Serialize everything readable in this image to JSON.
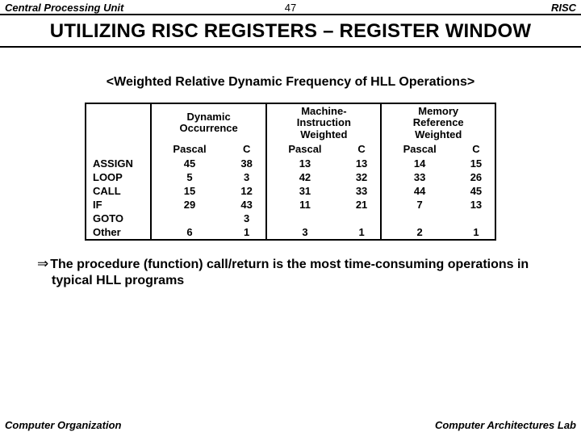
{
  "header": {
    "left": "Central Processing Unit",
    "page": "47",
    "right": "RISC"
  },
  "title": "UTILIZING RISC REGISTERS – REGISTER WINDOW",
  "subtitle": "<Weighted Relative Dynamic Frequency of HLL Operations>",
  "groups": {
    "g1": {
      "l1": "Dynamic",
      "l2": "Occurrence"
    },
    "g2": {
      "l1": "Machine-",
      "l2": "Instruction",
      "l3": "Weighted"
    },
    "g3": {
      "l1": "Memory",
      "l2": "Reference",
      "l3": "Weighted"
    }
  },
  "subcols": {
    "p": "Pascal",
    "c": "C"
  },
  "rows": {
    "r0": {
      "label": "ASSIGN",
      "g1p": "45",
      "g1c": "38",
      "g2p": "13",
      "g2c": "13",
      "g3p": "14",
      "g3c": "15"
    },
    "r1": {
      "label": "LOOP",
      "g1p": "5",
      "g1c": "3",
      "g2p": "42",
      "g2c": "32",
      "g3p": "33",
      "g3c": "26"
    },
    "r2": {
      "label": "CALL",
      "g1p": "15",
      "g1c": "12",
      "g2p": "31",
      "g2c": "33",
      "g3p": "44",
      "g3c": "45"
    },
    "r3": {
      "label": "IF",
      "g1p": "29",
      "g1c": "43",
      "g2p": "11",
      "g2c": "21",
      "g3p": "7",
      "g3c": "13"
    },
    "r4": {
      "label": "GOTO",
      "g1p": "",
      "g1c": "3",
      "g2p": "",
      "g2c": "",
      "g3p": "",
      "g3c": ""
    },
    "r5": {
      "label": "Other",
      "g1p": "6",
      "g1c": "1",
      "g2p": "3",
      "g2c": "1",
      "g3p": "2",
      "g3c": "1"
    }
  },
  "note": {
    "arrow": "⇒",
    "text": "The procedure (function) call/return is the most time-consuming operations in typical HLL programs"
  },
  "footer": {
    "left": "Computer Organization",
    "right": "Computer Architectures Lab"
  },
  "chart_data": {
    "type": "table",
    "title": "Weighted Relative Dynamic Frequency of HLL Operations",
    "row_labels": [
      "ASSIGN",
      "LOOP",
      "CALL",
      "IF",
      "GOTO",
      "Other"
    ],
    "column_groups": [
      "Dynamic Occurrence",
      "Machine-Instruction Weighted",
      "Memory Reference Weighted"
    ],
    "sub_columns": [
      "Pascal",
      "C"
    ],
    "values": [
      [
        [
          45,
          38
        ],
        [
          13,
          13
        ],
        [
          14,
          15
        ]
      ],
      [
        [
          5,
          3
        ],
        [
          42,
          32
        ],
        [
          33,
          26
        ]
      ],
      [
        [
          15,
          12
        ],
        [
          31,
          33
        ],
        [
          44,
          45
        ]
      ],
      [
        [
          29,
          43
        ],
        [
          11,
          21
        ],
        [
          7,
          13
        ]
      ],
      [
        [
          null,
          3
        ],
        [
          null,
          null
        ],
        [
          null,
          null
        ]
      ],
      [
        [
          6,
          1
        ],
        [
          3,
          1
        ],
        [
          2,
          1
        ]
      ]
    ]
  }
}
